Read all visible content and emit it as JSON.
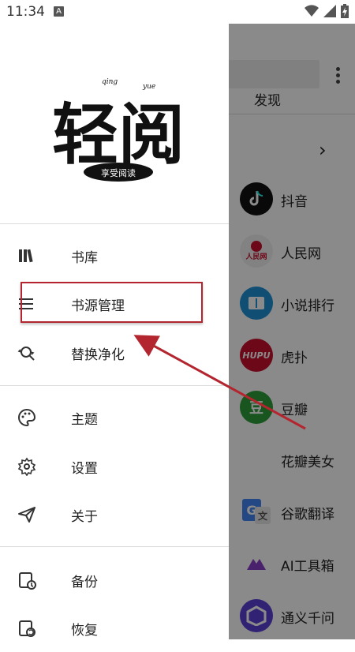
{
  "status_bar": {
    "time": "11:34",
    "notification_letter": "A"
  },
  "drawer": {
    "logo": {
      "title": "轻阅",
      "seal_text": "享受阅读",
      "pinyin_top": "qing",
      "pinyin_bottom": "yue"
    },
    "groups": [
      [
        {
          "label": "书库",
          "icon": "bookshelf-icon"
        },
        {
          "label": "书源管理",
          "icon": "menu-lines-icon"
        },
        {
          "label": "替换净化",
          "icon": "replace-search-icon"
        }
      ],
      [
        {
          "label": "主题",
          "icon": "palette-icon"
        },
        {
          "label": "设置",
          "icon": "gear-icon"
        },
        {
          "label": "关于",
          "icon": "send-icon"
        }
      ],
      [
        {
          "label": "备份",
          "icon": "backup-icon"
        },
        {
          "label": "恢复",
          "icon": "restore-icon"
        }
      ]
    ]
  },
  "background_app": {
    "tab": "发现",
    "sources": [
      {
        "label": "抖音",
        "icon_color": "#111111"
      },
      {
        "label": "人民网",
        "icon_color": "#f1f1f1"
      },
      {
        "label": "小说排行",
        "icon_color": "#1e90d6"
      },
      {
        "label": "虎扑",
        "icon_color": "#c8102e",
        "icon_text": "HUPU"
      },
      {
        "label": "豆瓣",
        "icon_color": "#2e9e3a",
        "icon_text": "豆"
      },
      {
        "label": "花瓣美女",
        "icon_color": ""
      },
      {
        "label": "谷歌翻译",
        "icon_color": "#4285f4"
      },
      {
        "label": "AI工具箱",
        "icon_color": "#ffffff"
      },
      {
        "label": "通义千问",
        "icon_color": "#5b3fd6"
      }
    ]
  },
  "colors": {
    "annotation_red": "#b3262f"
  }
}
